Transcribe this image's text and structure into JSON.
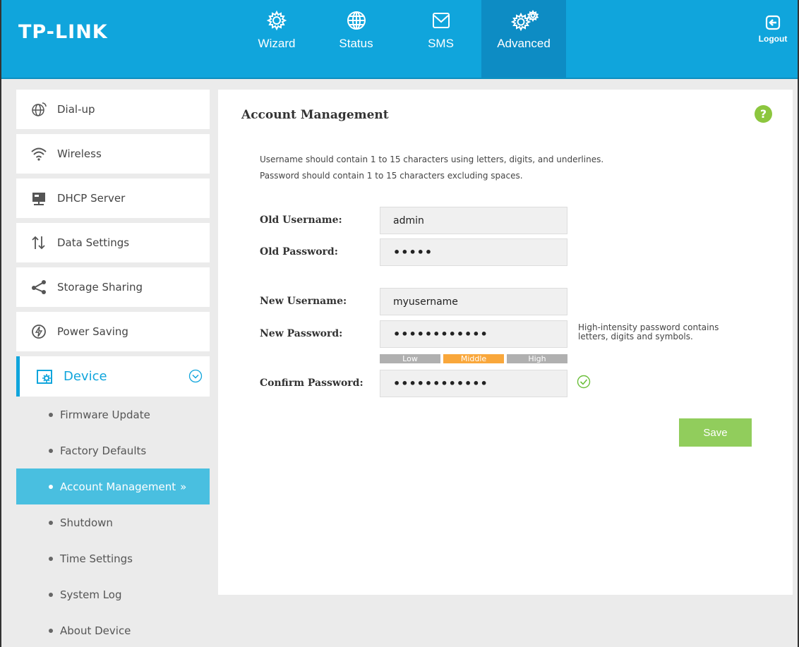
{
  "header": {
    "logo": "TP-LINK",
    "nav": [
      {
        "label": "Wizard",
        "icon": "gear-icon"
      },
      {
        "label": "Status",
        "icon": "globe-icon"
      },
      {
        "label": "SMS",
        "icon": "envelope-icon"
      },
      {
        "label": "Advanced",
        "icon": "gears-icon",
        "active": true
      }
    ],
    "logout_label": "Logout"
  },
  "sidebar": {
    "items": [
      {
        "label": "Dial-up",
        "icon": "globe-dialup-icon"
      },
      {
        "label": "Wireless",
        "icon": "wifi-icon"
      },
      {
        "label": "DHCP Server",
        "icon": "server-icon"
      },
      {
        "label": "Data Settings",
        "icon": "up-down-arrows-icon"
      },
      {
        "label": "Storage Sharing",
        "icon": "share-icon"
      },
      {
        "label": "Power Saving",
        "icon": "power-icon"
      }
    ],
    "device": {
      "label": "Device",
      "icon": "device-gear-icon",
      "subitems": [
        {
          "label": "Firmware Update"
        },
        {
          "label": "Factory Defaults"
        },
        {
          "label": "Account Management",
          "suffix": "»",
          "active": true
        },
        {
          "label": "Shutdown"
        },
        {
          "label": "Time Settings"
        },
        {
          "label": "System Log"
        },
        {
          "label": "About Device"
        }
      ]
    }
  },
  "main": {
    "title": "Account Management",
    "help_label": "?",
    "note_line1": "Username should contain 1 to 15 characters using letters, digits, and underlines.",
    "note_line2": "Password should contain 1 to 15 characters excluding spaces.",
    "old_username": {
      "label": "Old Username:",
      "value": "admin"
    },
    "old_password": {
      "label": "Old Password:",
      "value": "•••••"
    },
    "new_username": {
      "label": "New Username:",
      "value": "myusername"
    },
    "new_password": {
      "label": "New Password:",
      "value": "••••••••••••"
    },
    "confirm_password": {
      "label": "Confirm Password:",
      "value": "••••••••••••"
    },
    "password_hint_line1": "High-intensity password contains",
    "password_hint_line2": "letters, digits and symbols.",
    "strength": {
      "low": "Low",
      "middle": "Middle",
      "high": "High",
      "current": "Middle"
    },
    "save_label": "Save"
  },
  "colors": {
    "header_bg": "#10a5dc",
    "nav_active": "#0d8cc4",
    "accent": "#10a5dc",
    "submenu_active": "#49bfe0",
    "save_button": "#91cd5c",
    "strength_on": "#f9a73b",
    "help_button": "#8cc63e"
  }
}
